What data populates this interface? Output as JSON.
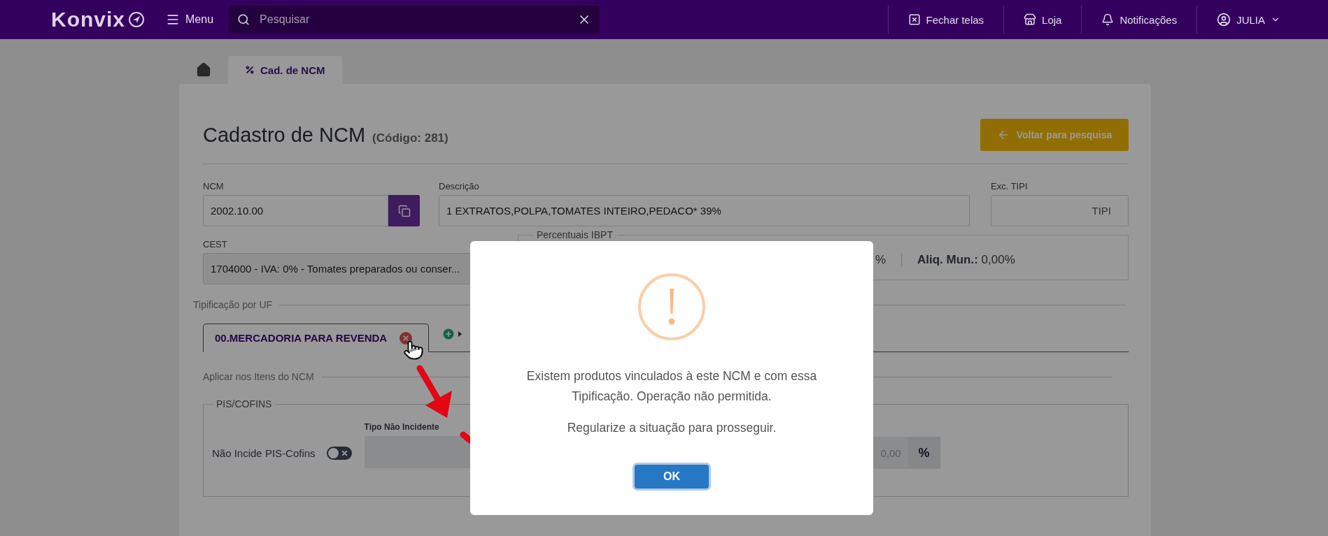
{
  "header": {
    "logo": "Konvix",
    "menu": "Menu",
    "search": {
      "placeholder": "Pesquisar"
    },
    "actions": [
      {
        "kind": "close-screens",
        "label": "Fechar telas"
      },
      {
        "kind": "store",
        "label": "Loja"
      },
      {
        "kind": "notifications",
        "label": "Notificações"
      }
    ],
    "user": "JULIA"
  },
  "page_tabs": [
    {
      "kind": "home",
      "selected": false
    },
    {
      "kind": "page",
      "label": "Cad. de NCM",
      "selected": true
    }
  ],
  "form": {
    "title": "Cadastro de NCM",
    "code": "(Código: 281)",
    "back_button": "Voltar para pesquisa",
    "ncm": {
      "label": "NCM",
      "value": "2002.10.00"
    },
    "descricao": {
      "label": "Descrição",
      "value": "1 EXTRATOS,POLPA,TOMATES INTEIRO,PEDACO* 39%"
    },
    "exc_tipi": {
      "label": "Exc. TIPI",
      "suffix": "TIPI"
    },
    "cest": {
      "label": "CEST",
      "value": "1704000 - IVA: 0% - Tomates preparados ou conser..."
    },
    "ibpt": {
      "legend": "Percentuais IBPT",
      "items": [
        {
          "value": "%"
        },
        {
          "label": "Aliq. Mun.:",
          "value": "0,00%"
        }
      ]
    },
    "tipificacao": {
      "legend": "Tipificação por UF",
      "tabs": [
        {
          "label": "00.MERCADORIA PARA REVENDA",
          "selected": true
        }
      ],
      "apply_legend": "Aplicar nos Itens do NCM",
      "pis_cofins": {
        "legend": "PIS/COFINS",
        "toggle": {
          "label": "Não Incide PIS-Cofins",
          "on": false
        },
        "tipo": {
          "label": "Tipo Não Incidente"
        },
        "rate": {
          "placeholder": "0,00",
          "suffix": "%"
        }
      }
    }
  },
  "dialog": {
    "message": "Existem produtos vinculados à este NCM e com essa Tipificação. Operação não permitida.",
    "note": "Regularize a situação para prosseguir.",
    "button": "OK"
  }
}
